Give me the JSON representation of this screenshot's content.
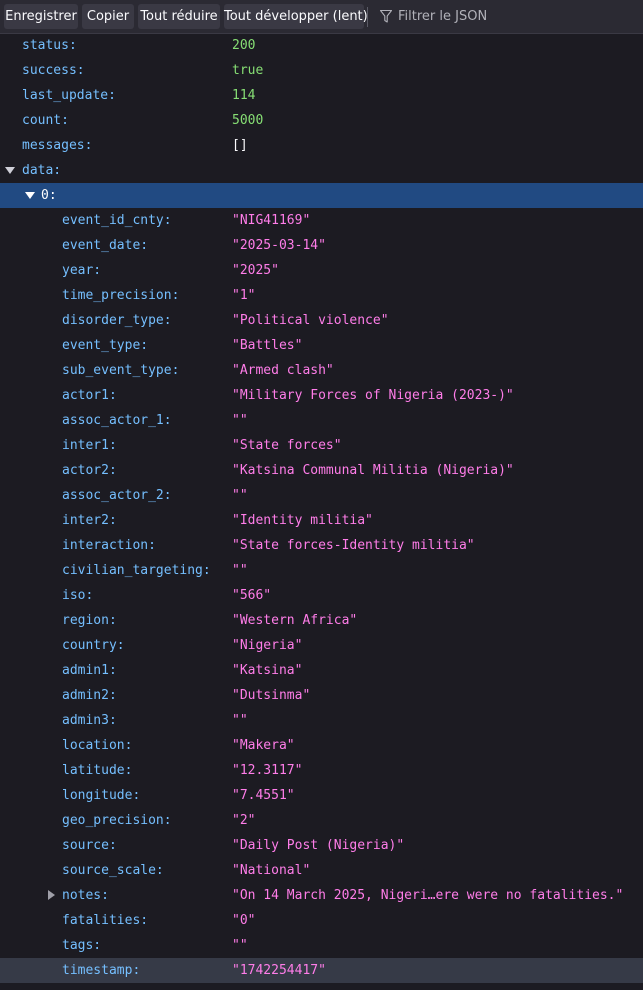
{
  "toolbar": {
    "save_label": "Enregistrer",
    "copy_label": "Copier",
    "collapse_all_label": "Tout réduire",
    "expand_all_label": "Tout développer (lent)",
    "filter_placeholder": "Filtrer le JSON"
  },
  "root": [
    {
      "key": "status:",
      "value": "200"
    },
    {
      "key": "success:",
      "value": "true"
    },
    {
      "key": "last_update:",
      "value": "114"
    },
    {
      "key": "count:",
      "value": "5000"
    },
    {
      "key": "messages:",
      "value": "[]"
    },
    {
      "key": "data:",
      "value": ""
    }
  ],
  "item0": {
    "key": "0:",
    "fields": [
      {
        "key": "event_id_cnty:",
        "value": "\"NIG41169\""
      },
      {
        "key": "event_date:",
        "value": "\"2025-03-14\""
      },
      {
        "key": "year:",
        "value": "\"2025\""
      },
      {
        "key": "time_precision:",
        "value": "\"1\""
      },
      {
        "key": "disorder_type:",
        "value": "\"Political violence\""
      },
      {
        "key": "event_type:",
        "value": "\"Battles\""
      },
      {
        "key": "sub_event_type:",
        "value": "\"Armed clash\""
      },
      {
        "key": "actor1:",
        "value": "\"Military Forces of Nigeria (2023-)\""
      },
      {
        "key": "assoc_actor_1:",
        "value": "\"\""
      },
      {
        "key": "inter1:",
        "value": "\"State forces\""
      },
      {
        "key": "actor2:",
        "value": "\"Katsina Communal Militia (Nigeria)\""
      },
      {
        "key": "assoc_actor_2:",
        "value": "\"\""
      },
      {
        "key": "inter2:",
        "value": "\"Identity militia\""
      },
      {
        "key": "interaction:",
        "value": "\"State forces-Identity militia\""
      },
      {
        "key": "civilian_targeting:",
        "value": "\"\""
      },
      {
        "key": "iso:",
        "value": "\"566\""
      },
      {
        "key": "region:",
        "value": "\"Western Africa\""
      },
      {
        "key": "country:",
        "value": "\"Nigeria\""
      },
      {
        "key": "admin1:",
        "value": "\"Katsina\""
      },
      {
        "key": "admin2:",
        "value": "\"Dutsinma\""
      },
      {
        "key": "admin3:",
        "value": "\"\""
      },
      {
        "key": "location:",
        "value": "\"Makera\""
      },
      {
        "key": "latitude:",
        "value": "\"12.3117\""
      },
      {
        "key": "longitude:",
        "value": "\"7.4551\""
      },
      {
        "key": "geo_precision:",
        "value": "\"2\""
      },
      {
        "key": "source:",
        "value": "\"Daily Post (Nigeria)\""
      },
      {
        "key": "source_scale:",
        "value": "\"National\""
      },
      {
        "key": "notes:",
        "value": "\"On 14 March 2025, Nigeri…ere were no fatalities.\""
      },
      {
        "key": "fatalities:",
        "value": "\"0\""
      },
      {
        "key": "tags:",
        "value": "\"\""
      },
      {
        "key": "timestamp:",
        "value": "\"1742254417\""
      }
    ]
  },
  "colors": {
    "background": "#1c1b22",
    "key": "#75bfff",
    "string": "#ff7de9",
    "number": "#86de74",
    "selected_row": "#214a82",
    "hover_row": "#363a47"
  }
}
